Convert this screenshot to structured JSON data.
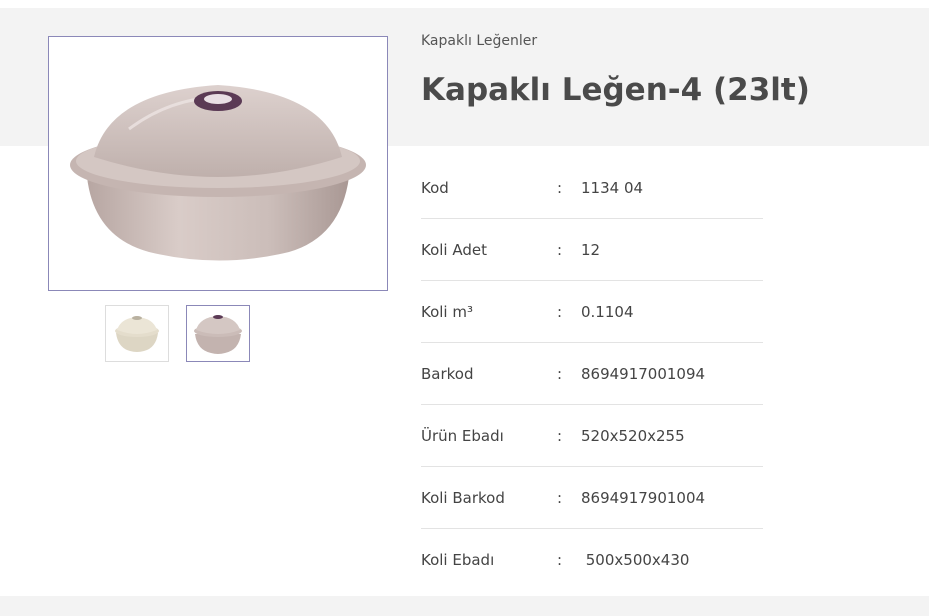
{
  "breadcrumb": "Kapaklı Leğenler",
  "product": {
    "title": "Kapaklı Leğen-4 (23lt)"
  },
  "specs": [
    {
      "label": "Kod",
      "value": "1134 04"
    },
    {
      "label": "Koli Adet",
      "value": "12"
    },
    {
      "label": "Koli m³",
      "value": "0.1104"
    },
    {
      "label": "Barkod",
      "value": "8694917001094"
    },
    {
      "label": "Ürün Ebadı",
      "value": "520x520x255"
    },
    {
      "label": "Koli Barkod",
      "value": "8694917901004"
    },
    {
      "label": "Koli Ebadı",
      "value": " 500x500x430"
    }
  ],
  "separator": ":",
  "colors": {
    "header_band": "#f3f3f3",
    "thumb_active_border": "#8b88b8",
    "product_main": "#c8b8b4",
    "product_alt": "#e6e0d0",
    "lid_knob": "#5b3a55"
  },
  "thumbnails": [
    {
      "icon": "bowl-cream-icon",
      "active": false
    },
    {
      "icon": "bowl-mauve-icon",
      "active": true
    }
  ]
}
